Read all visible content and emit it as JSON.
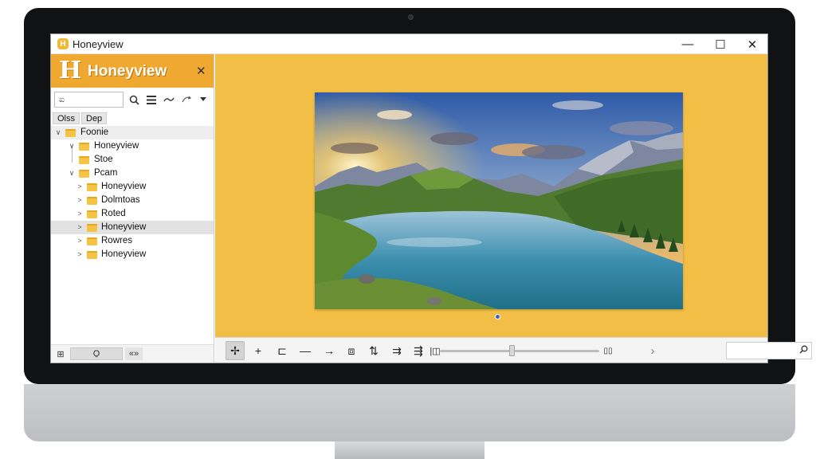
{
  "window": {
    "title": "Honeyview",
    "logo_glyph": "H",
    "controls": {
      "minimize": "—",
      "maximize": "☐",
      "close": "✕"
    }
  },
  "panel": {
    "title": "Honeyview",
    "logo_glyph": "H",
    "close_glyph": "✕",
    "search_value": "ಐ",
    "toolbar_icons": [
      "search-icon",
      "list-icon",
      "wave-icon",
      "refresh-icon",
      "dropdown-icon"
    ],
    "tabs": [
      "Olss",
      "Dep"
    ],
    "tree": [
      {
        "label": "Foonie",
        "arrow": "∨",
        "level": 0,
        "state": "root"
      },
      {
        "label": "Honeyview",
        "arrow": "∨",
        "level": 1
      },
      {
        "label": "Stoe",
        "arrow": "",
        "level": 1
      },
      {
        "label": "Pcam",
        "arrow": "∨",
        "level": 1
      },
      {
        "label": "Honeyview",
        "arrow": ">",
        "level": 2
      },
      {
        "label": "Dolmtoas",
        "arrow": ">",
        "level": 2
      },
      {
        "label": "Roted",
        "arrow": ">",
        "level": 2
      },
      {
        "label": "Honeyview",
        "arrow": ">",
        "level": 2,
        "state": "selected"
      },
      {
        "label": "Rowres",
        "arrow": ">",
        "level": 2
      },
      {
        "label": "Honeyview",
        "arrow": ">",
        "level": 2
      }
    ],
    "footer": {
      "left_glyph": "⊞",
      "middle_glyph": "O̱",
      "right_glyph": "«»"
    }
  },
  "viewer": {
    "background": "#f2be45",
    "image_description_icon": "landscape-photo"
  },
  "toolbar": {
    "buttons": [
      {
        "name": "crop-tool-button",
        "glyph": "✢",
        "active": true
      },
      {
        "name": "add-button",
        "glyph": "+"
      },
      {
        "name": "frame-button",
        "glyph": "⊏"
      },
      {
        "name": "line-button",
        "glyph": "—"
      },
      {
        "name": "arrow-button",
        "glyph": "→"
      },
      {
        "name": "gallery-button",
        "glyph": "⧈"
      },
      {
        "name": "adjust-button",
        "glyph": "⇅"
      },
      {
        "name": "align-button",
        "glyph": "⇉"
      },
      {
        "name": "flow-button",
        "glyph": "⇶"
      }
    ],
    "slider_value": 0.45,
    "slider_left_glyph": "|◫",
    "slider_right_glyph": "▯▯",
    "next_glyph": "›",
    "search_icon": "🔍"
  },
  "colors": {
    "accent": "#f0a930",
    "viewer_bg": "#f2be45"
  }
}
